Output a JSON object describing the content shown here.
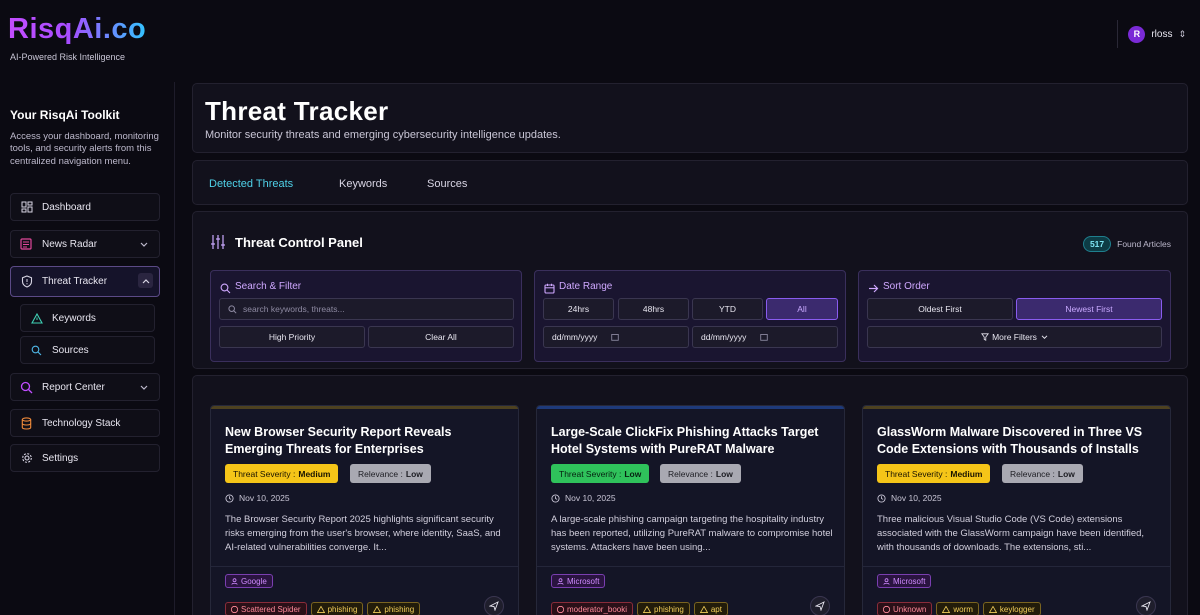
{
  "brand": {
    "name": "RisqAi.co",
    "tagline": "AI-Powered Risk Intelligence"
  },
  "user": {
    "initial": "R",
    "name": "rloss"
  },
  "sidebar": {
    "title": "Your RisqAi Toolkit",
    "description": "Access your dashboard, monitoring tools, and security alerts from this centralized navigation menu.",
    "items": [
      {
        "label": "Dashboard",
        "icon": "dashboard-icon"
      },
      {
        "label": "News Radar",
        "icon": "newspaper-icon"
      },
      {
        "label": "Threat Tracker",
        "icon": "shield-icon",
        "active": true
      },
      {
        "label": "Keywords",
        "icon": "warning-triangle-icon"
      },
      {
        "label": "Sources",
        "icon": "search-icon"
      },
      {
        "label": "Report Center",
        "icon": "search-icon"
      },
      {
        "label": "Technology Stack",
        "icon": "database-icon"
      },
      {
        "label": "Settings",
        "icon": "gear-icon"
      }
    ]
  },
  "header": {
    "title": "Threat Tracker",
    "subtitle": "Monitor security threats and emerging cybersecurity intelligence updates."
  },
  "tabs": [
    {
      "label": "Detected Threats",
      "active": true
    },
    {
      "label": "Keywords"
    },
    {
      "label": "Sources"
    }
  ],
  "control_panel": {
    "title": "Threat Control Panel",
    "found_count": "517",
    "found_label": "Found Articles",
    "search": {
      "title": "Search & Filter",
      "placeholder": "search keywords, threats...",
      "high_priority": "High Priority",
      "clear_all": "Clear All"
    },
    "date_range": {
      "title": "Date Range",
      "options": [
        "24hrs",
        "48hrs",
        "YTD",
        "All"
      ],
      "selected": "All",
      "from_placeholder": "dd/mm/yyyy",
      "to_placeholder": "dd/mm/yyyy"
    },
    "sort": {
      "title": "Sort Order",
      "oldest": "Oldest First",
      "newest": "Newest First",
      "selected": "Newest First",
      "more_filters": "More Filters"
    }
  },
  "articles": [
    {
      "title": "New Browser Security Report Reveals Emerging Threats for Enterprises",
      "severity_label": "Threat Severity :",
      "severity": "Medium",
      "relevance_label": "Relevance :",
      "relevance": "Low",
      "date": "Nov 10, 2025",
      "excerpt": "The Browser Security Report 2025 highlights significant security risks emerging from the user's browser, where identity, SaaS, and AI-related vulnerabilities converge. It...",
      "org": "Google",
      "actor": "Scattered Spider",
      "keywords": [
        "phishing",
        "phishing"
      ],
      "accent": "#5a4a1a"
    },
    {
      "title": "Large-Scale ClickFix Phishing Attacks Target Hotel Systems with PureRAT Malware",
      "severity_label": "Threat Severity :",
      "severity": "Low",
      "relevance_label": "Relevance :",
      "relevance": "Low",
      "date": "Nov 10, 2025",
      "excerpt": "A large-scale phishing campaign targeting the hospitality industry has been reported, utilizing PureRAT malware to compromise hotel systems. Attackers have been using...",
      "org": "Microsoft",
      "actor": "moderator_booki",
      "keywords": [
        "phishing",
        "apt"
      ],
      "accent": "#1e3a7a"
    },
    {
      "title": "GlassWorm Malware Discovered in Three VS Code Extensions with Thousands of Installs",
      "severity_label": "Threat Severity :",
      "severity": "Medium",
      "relevance_label": "Relevance :",
      "relevance": "Low",
      "date": "Nov 10, 2025",
      "excerpt": "Three malicious Visual Studio Code (VS Code) extensions associated with the GlassWorm campaign have been identified, with thousands of downloads. The extensions, sti...",
      "org": "Microsoft",
      "actor": "Unknown",
      "keywords": [
        "worm",
        "keylogger"
      ],
      "accent": "#5a4a1a"
    }
  ]
}
